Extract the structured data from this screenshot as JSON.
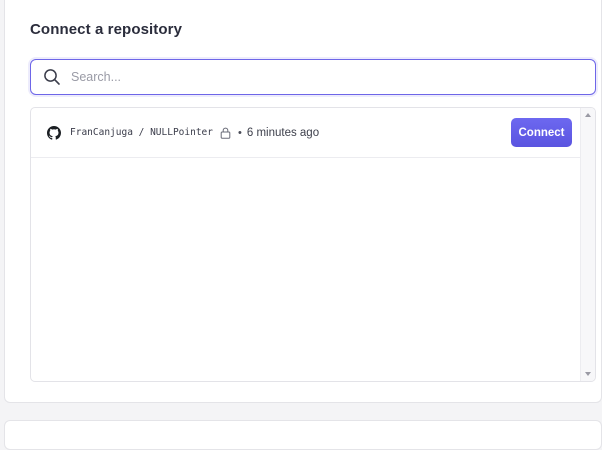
{
  "page": {
    "title": "Connect a repository"
  },
  "search": {
    "placeholder": "Search...",
    "value": ""
  },
  "repositories": [
    {
      "name": "FranCanjuga / NULLPointer",
      "visibility_icon": "lock-icon",
      "separator": "•",
      "updated": "6 minutes ago",
      "action_label": "Connect"
    }
  ],
  "colors": {
    "accent": "#5f59e6",
    "border": "#e3e3e8",
    "title_text": "#2b2d3c"
  }
}
